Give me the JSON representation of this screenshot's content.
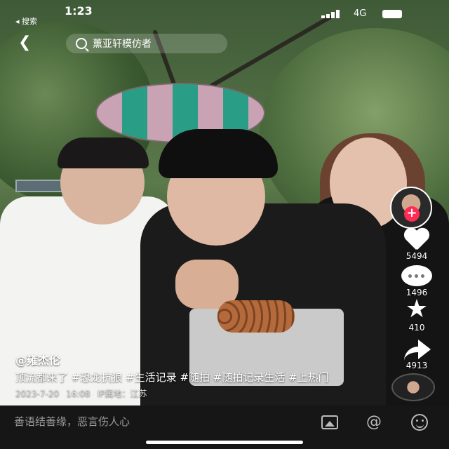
{
  "status_bar": {
    "back_app": "◂ 搜索",
    "time": "1:23",
    "network": "4G"
  },
  "top_bar": {
    "search_text": "薰亚轩模仿者"
  },
  "rail": {
    "likes": "5494",
    "comments": "1496",
    "favorites": "410",
    "shares": "4913"
  },
  "caption": {
    "author": "@雍杰伦",
    "description": "顶流都来了 #恐龙抗狼 #生活记录 #随拍 #随拍记录生活 #上热门",
    "date": "2023-7-20",
    "time": "16:08",
    "location_label": "IP属地：江苏"
  },
  "comment_bar": {
    "placeholder": "善语结善缘，恶言伤人心"
  },
  "icons": {
    "back": "chevron-left-icon",
    "search": "search-icon",
    "like": "heart-icon",
    "comment": "comment-bubble-icon",
    "favorite": "star-icon",
    "share": "share-arrow-icon",
    "image": "image-icon",
    "mention": "at-icon",
    "emoji": "emoji-icon"
  },
  "colors": {
    "follow_accent": "#fe2c55",
    "comment_bar_bg": "#161616"
  }
}
